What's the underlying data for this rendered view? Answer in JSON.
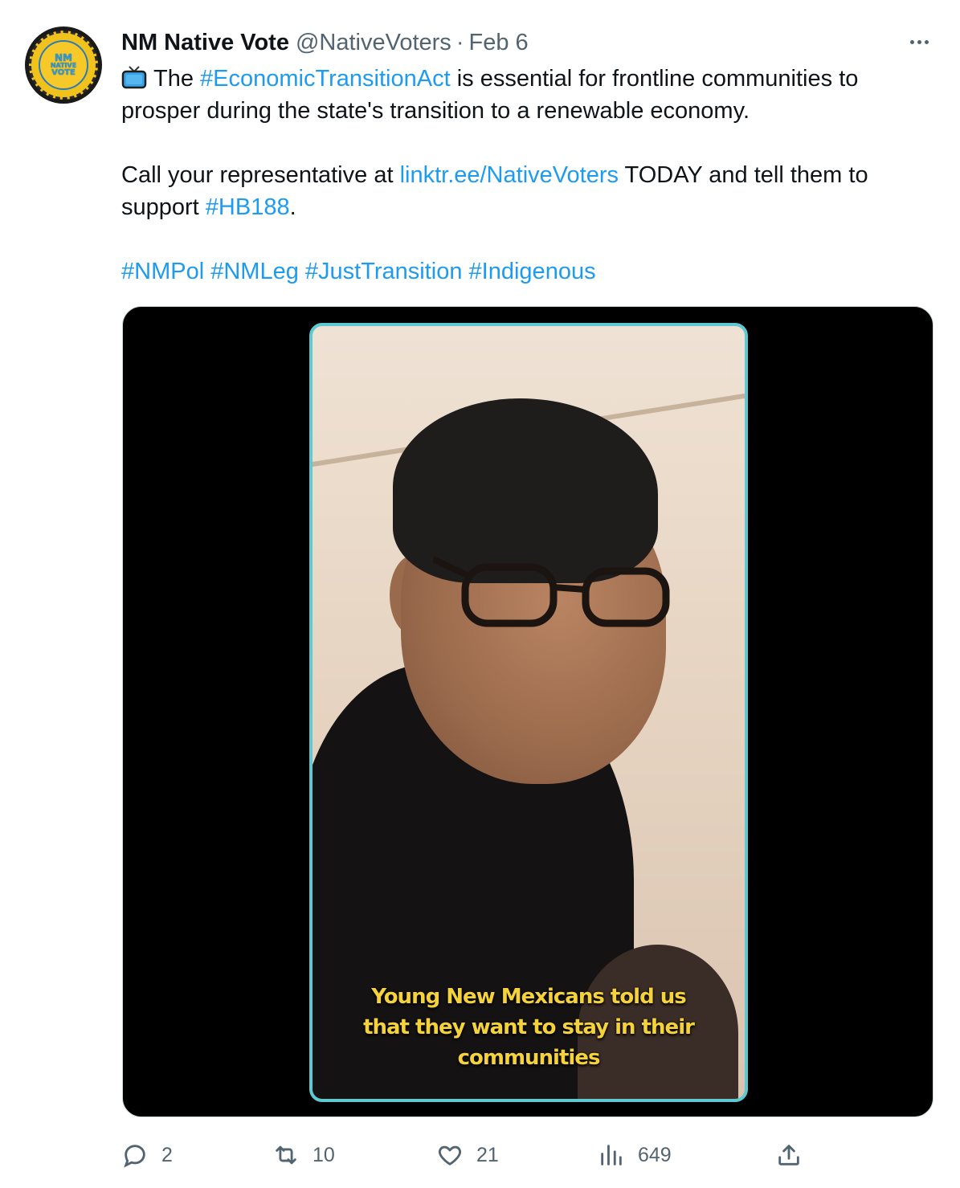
{
  "tweet": {
    "author": {
      "display_name": "NM Native Vote",
      "handle": "@NativeVoters",
      "avatar_text": [
        "NM",
        "NATIVE",
        "VOTE"
      ]
    },
    "separator": "·",
    "date": "Feb 6",
    "text": {
      "line1_emoji": "television-icon",
      "line1_before": "The",
      "hashtag_1": "#EconomicTransitionAct",
      "line1_after": "is essential for frontline communities to prosper during the state's transition to a renewable economy.",
      "line2_before": "Call your representative at",
      "link": "linktr.ee/NativeVoters",
      "line2_middle": "TODAY and tell them to support",
      "hashtag_2": "#HB188",
      "line2_end": ".",
      "hashtags": [
        "#NMPol",
        "#NMLeg",
        "#JustTransition",
        "#Indigenous"
      ]
    },
    "media": {
      "caption_lines": [
        "Young New Mexicans told us",
        "that they want to stay in their",
        "communities"
      ]
    },
    "stats": {
      "replies": "2",
      "retweets": "10",
      "likes": "21",
      "views": "649"
    }
  },
  "colors": {
    "link": "#1d9bf0",
    "muted": "#536471",
    "caption": "#f5d23a",
    "video_border": "#5ec9d0"
  }
}
